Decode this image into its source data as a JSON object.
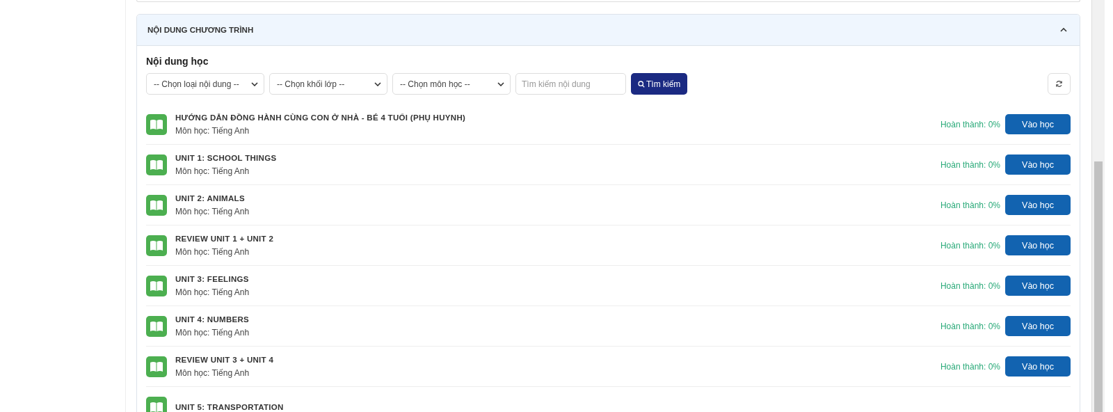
{
  "section": {
    "title": "NỘI DUNG CHƯƠNG TRÌNH",
    "expanded": true
  },
  "content": {
    "heading": "Nội dung học",
    "filters": [
      {
        "kind": "select",
        "placeholder": "-- Chọn loại nội dung --"
      },
      {
        "kind": "select",
        "placeholder": "-- Chọn khối lớp --"
      },
      {
        "kind": "select",
        "placeholder": "-- Chọn môn học --"
      },
      {
        "kind": "input",
        "placeholder": "Tìm kiếm nội dung"
      }
    ],
    "search_button": "Tìm kiếm",
    "lessons": [
      {
        "title": "HƯỚNG DẪN ĐỒNG HÀNH CÙNG CON Ở NHÀ - BÉ 4 TUỔI (PHỤ HUYNH)",
        "subject": "Môn học: Tiếng Anh",
        "progress": "Hoàn thành: 0%",
        "button": "Vào học"
      },
      {
        "title": "UNIT 1: SCHOOL THINGS",
        "subject": "Môn học: Tiếng Anh",
        "progress": "Hoàn thành: 0%",
        "button": "Vào học"
      },
      {
        "title": "UNIT 2: ANIMALS",
        "subject": "Môn học: Tiếng Anh",
        "progress": "Hoàn thành: 0%",
        "button": "Vào học"
      },
      {
        "title": "REVIEW UNIT 1 + UNIT 2",
        "subject": "Môn học: Tiếng Anh",
        "progress": "Hoàn thành: 0%",
        "button": "Vào học"
      },
      {
        "title": "UNIT 3: FEELINGS",
        "subject": "Môn học: Tiếng Anh",
        "progress": "Hoàn thành: 0%",
        "button": "Vào học"
      },
      {
        "title": "UNIT 4: NUMBERS",
        "subject": "Môn học: Tiếng Anh",
        "progress": "Hoàn thành: 0%",
        "button": "Vào học"
      },
      {
        "title": "REVIEW UNIT 3 + UNIT 4",
        "subject": "Môn học: Tiếng Anh",
        "progress": "Hoàn thành: 0%",
        "button": "Vào học"
      },
      {
        "title": "UNIT 5: TRANSPORTATION"
      }
    ]
  }
}
